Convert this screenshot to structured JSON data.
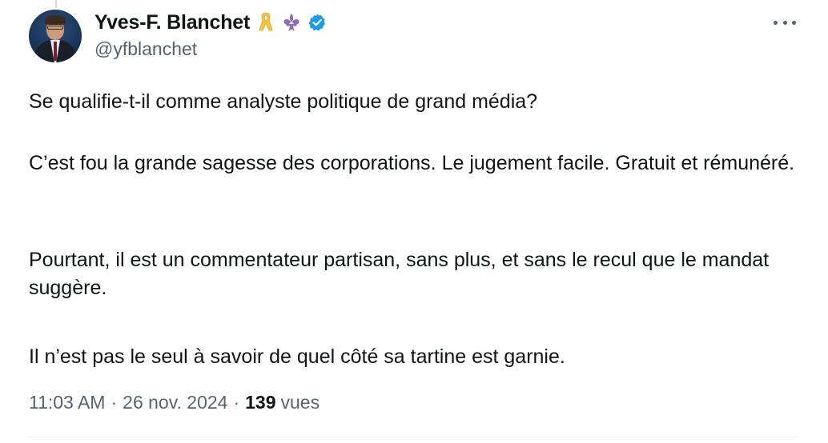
{
  "author": {
    "display_name": "Yves-F. Blanchet",
    "handle": "@yfblanchet",
    "badges": [
      "yellow-ribbon-icon",
      "fleur-de-lis-icon",
      "verified-badge-icon"
    ]
  },
  "tweet": {
    "paragraphs": [
      "Se qualifie-t-il comme analyste politique de grand média?",
      "C’est fou la grande sagesse des corporations. Le jugement facile. Gratuit et rémunéré.",
      "Pourtant, il est un commentateur partisan, sans plus, et sans le recul que le mandat suggère.",
      "Il n’est pas le seul à savoir de quel côté sa tartine est garnie."
    ],
    "time": "11:03 AM",
    "separator": "·",
    "date": "26 nov. 2024",
    "views_count": "139",
    "views_label": "vues"
  },
  "colors": {
    "text_primary": "#0f1419",
    "text_secondary": "#536471",
    "verified_blue": "#1d9bf0",
    "ribbon_yellow": "#f5c542",
    "fleur_purple": "#8e6bb8"
  }
}
